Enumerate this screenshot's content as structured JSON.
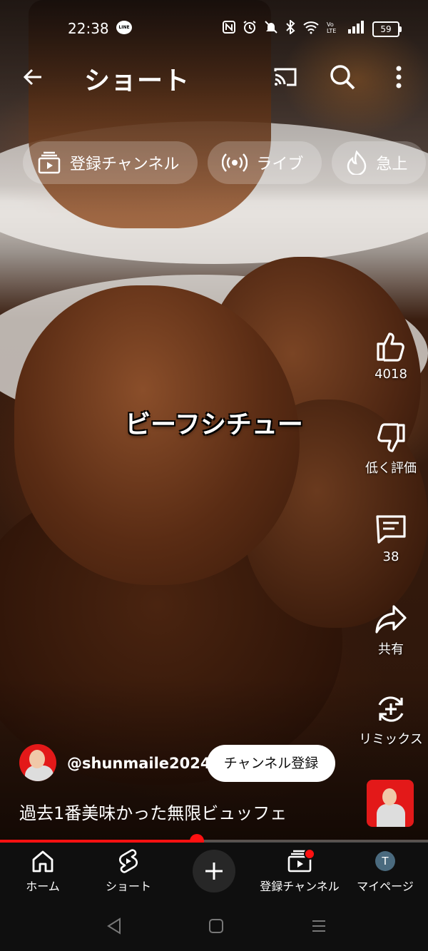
{
  "status_bar": {
    "time": "22:38",
    "line_badge": "LINE",
    "battery": "59"
  },
  "header": {
    "title": "ショート"
  },
  "chips": [
    {
      "label": "登録チャンネル",
      "icon": "subscriptions-icon"
    },
    {
      "label": "ライブ",
      "icon": "live-icon"
    },
    {
      "label": "急上",
      "icon": "trending-icon"
    }
  ],
  "video": {
    "caption": "ビーフシチュー",
    "title": "過去1番美味かった無限ビュッフェ",
    "progress": 0.46
  },
  "actions": {
    "like_count": "4018",
    "dislike_label": "低く評価",
    "comment_count": "38",
    "share_label": "共有",
    "remix_label": "リミックス"
  },
  "channel": {
    "handle": "@shunmaile2024",
    "subscribe_label": "チャンネル登録"
  },
  "bottom_nav": {
    "home": "ホーム",
    "shorts": "ショート",
    "subscriptions": "登録チャンネル",
    "you": "マイページ",
    "you_initial": "T"
  },
  "colors": {
    "accent": "#ff1111",
    "nav_bg": "#0f0f0f"
  }
}
